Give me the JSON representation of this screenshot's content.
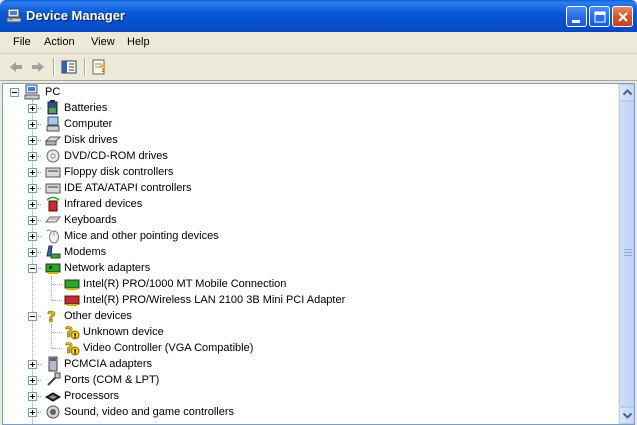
{
  "window": {
    "title": "Device Manager",
    "colors": {
      "titlebar": "#0a58d6",
      "close": "#d8542c",
      "face": "#ece9d8"
    }
  },
  "menu": [
    "File",
    "Action",
    "View",
    "Help"
  ],
  "toolbar": {
    "buttons": [
      "back-arrow-icon",
      "forward-arrow-icon",
      "show-hide-console-tree-icon",
      "properties-icon"
    ]
  },
  "tree": {
    "root": "PC",
    "items": [
      {
        "label": "Batteries",
        "icon": "battery-icon",
        "state": "collapsed"
      },
      {
        "label": "Computer",
        "icon": "computer-icon",
        "state": "collapsed"
      },
      {
        "label": "Disk drives",
        "icon": "disk-drive-icon",
        "state": "collapsed"
      },
      {
        "label": "DVD/CD-ROM drives",
        "icon": "cd-drive-icon",
        "state": "collapsed"
      },
      {
        "label": "Floppy disk controllers",
        "icon": "controller-icon",
        "state": "collapsed"
      },
      {
        "label": "IDE ATA/ATAPI controllers",
        "icon": "controller-icon",
        "state": "collapsed"
      },
      {
        "label": "Infrared devices",
        "icon": "infrared-icon",
        "state": "collapsed"
      },
      {
        "label": "Keyboards",
        "icon": "keyboard-icon",
        "state": "collapsed"
      },
      {
        "label": "Mice and other pointing devices",
        "icon": "mouse-icon",
        "state": "collapsed"
      },
      {
        "label": "Modems",
        "icon": "modem-icon",
        "state": "collapsed"
      },
      {
        "label": "Network adapters",
        "icon": "network-adapter-icon",
        "state": "expanded",
        "children": [
          {
            "label": "Intel(R) PRO/1000 MT Mobile Connection",
            "icon": "network-card-icon"
          },
          {
            "label": "Intel(R) PRO/Wireless LAN 2100 3B Mini PCI Adapter",
            "icon": "network-card-red-icon"
          }
        ]
      },
      {
        "label": "Other devices",
        "icon": "question-icon",
        "state": "expanded",
        "children": [
          {
            "label": "Unknown device",
            "icon": "warning-device-icon"
          },
          {
            "label": "Video Controller (VGA Compatible)",
            "icon": "warning-device-icon"
          }
        ]
      },
      {
        "label": "PCMCIA adapters",
        "icon": "pcmcia-icon",
        "state": "collapsed"
      },
      {
        "label": "Ports (COM & LPT)",
        "icon": "port-icon",
        "state": "collapsed"
      },
      {
        "label": "Processors",
        "icon": "processor-icon",
        "state": "collapsed"
      },
      {
        "label": "Sound, video and game controllers",
        "icon": "sound-icon",
        "state": "collapsed"
      }
    ]
  }
}
